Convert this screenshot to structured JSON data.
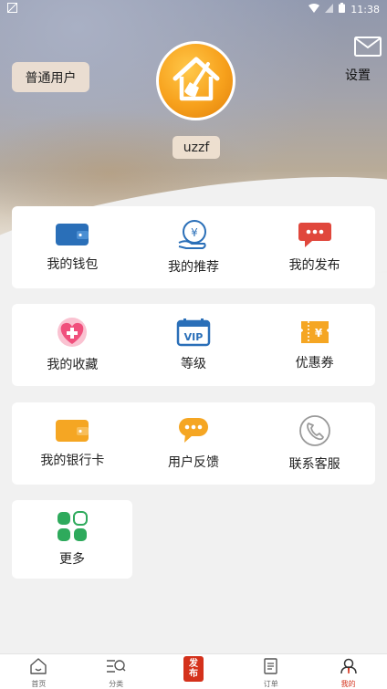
{
  "status_bar": {
    "time": "11:38"
  },
  "header": {
    "user_type": "普通用户",
    "username": "uzzf",
    "settings_label": "设置"
  },
  "cards": [
    {
      "items": [
        {
          "label": "我的钱包",
          "icon": "wallet-icon"
        },
        {
          "label": "我的推荐",
          "icon": "yuan-hand-icon"
        },
        {
          "label": "我的发布",
          "icon": "message-icon"
        }
      ]
    },
    {
      "items": [
        {
          "label": "我的收藏",
          "icon": "heart-plus-icon"
        },
        {
          "label": "等级",
          "icon": "vip-icon"
        },
        {
          "label": "优惠券",
          "icon": "coupon-icon"
        }
      ]
    },
    {
      "items": [
        {
          "label": "我的银行卡",
          "icon": "bank-card-icon"
        },
        {
          "label": "用户反馈",
          "icon": "feedback-icon"
        },
        {
          "label": "联系客服",
          "icon": "phone-icon"
        }
      ]
    },
    {
      "items": [
        {
          "label": "更多",
          "icon": "more-icon"
        }
      ]
    }
  ],
  "bottom_nav": {
    "items": [
      {
        "label": "首页",
        "icon": "home-icon"
      },
      {
        "label": "分类",
        "icon": "category-search-icon"
      },
      {
        "label": "发布",
        "icon": "publish-icon",
        "badge_line1": "发",
        "badge_line2": "布"
      },
      {
        "label": "订单",
        "icon": "order-icon"
      },
      {
        "label": "我的",
        "icon": "profile-icon",
        "active": true
      }
    ]
  },
  "colors": {
    "accent": "#d4311b",
    "wallet_blue": "#2a6fb8",
    "message_red": "#e0473c",
    "pink": "#f04f7c",
    "orange": "#f5a623",
    "green": "#2eaa5c",
    "gray_icon": "#9a9a9a"
  }
}
